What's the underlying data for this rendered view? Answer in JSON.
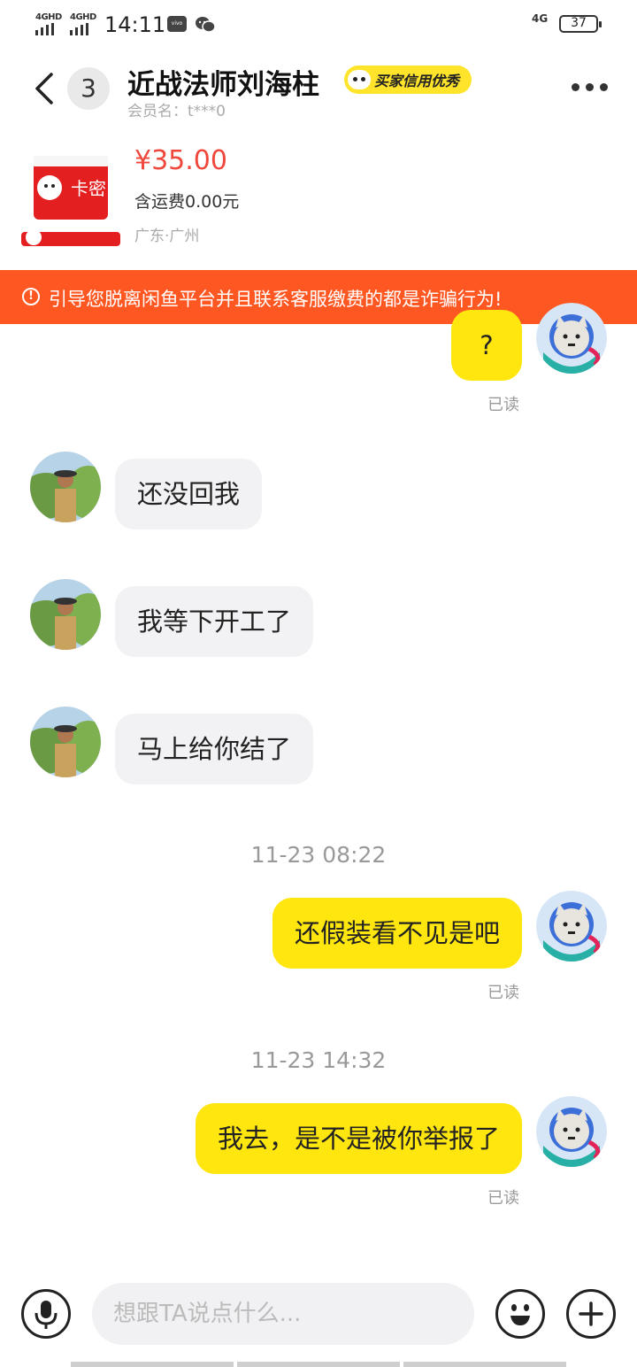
{
  "status_bar": {
    "signal1": "4GHD",
    "signal2": "4GHD",
    "time": "14:11",
    "vivo": "vivo",
    "network": "4G",
    "battery": "37"
  },
  "header": {
    "unread_count": "3",
    "title": "近战法师刘海柱",
    "credit_badge": "买家信用优秀",
    "member_label": "会员名：t***0"
  },
  "product": {
    "price": "¥35.00",
    "shipping": "含运费0.00元",
    "location": "广东·广州",
    "thumb_text": "卡密"
  },
  "warning": "引导您脱离闲鱼平台并且联系客服缴费的都是诈骗行为!",
  "messages": [
    {
      "text": "?",
      "read": "已读"
    },
    {
      "text": "还没回我"
    },
    {
      "text": "我等下开工了"
    },
    {
      "text": "马上给你结了"
    },
    {
      "timestamp": "11-23 08:22"
    },
    {
      "text": "还假装看不见是吧",
      "read": "已读"
    },
    {
      "timestamp": "11-23 14:32"
    },
    {
      "text": "我去，是不是被你举报了",
      "read": "已读"
    }
  ],
  "input": {
    "placeholder": "想跟TA说点什么..."
  },
  "colors": {
    "accent_yellow": "#ffe60f",
    "warning_orange": "#ff5722",
    "price_red": "#f0473c"
  }
}
